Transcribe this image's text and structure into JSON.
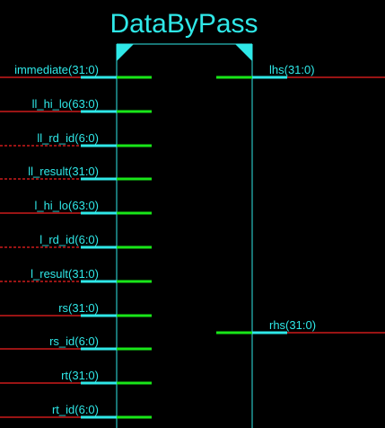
{
  "block": {
    "title": "DataByPass"
  },
  "inputs": [
    {
      "label": "immediate(31:0)",
      "bus": true
    },
    {
      "label": "ll_hi_lo(63:0)",
      "bus": true
    },
    {
      "label": "ll_rd_id(6:0)",
      "bus": true
    },
    {
      "label": "ll_result(31:0)",
      "bus": true
    },
    {
      "label": "l_hi_lo(63:0)",
      "bus": true
    },
    {
      "label": "l_rd_id(6:0)",
      "bus": true
    },
    {
      "label": "l_result(31:0)",
      "bus": true
    },
    {
      "label": "rs(31:0)",
      "bus": true
    },
    {
      "label": "rs_id(6:0)",
      "bus": true
    },
    {
      "label": "rt(31:0)",
      "bus": true
    },
    {
      "label": "rt_id(6:0)",
      "bus": true
    }
  ],
  "outputs": [
    {
      "label": "lhs(31:0)",
      "bus": true
    },
    {
      "label": "rhs(31:0)",
      "bus": true
    }
  ],
  "colors": {
    "background": "#000000",
    "block_outline": "#2fe8e8",
    "pin": "#19e619",
    "bus_marker": "#2fe8e8",
    "wire": "#cc1a1a",
    "label": "#2fe8e8"
  }
}
